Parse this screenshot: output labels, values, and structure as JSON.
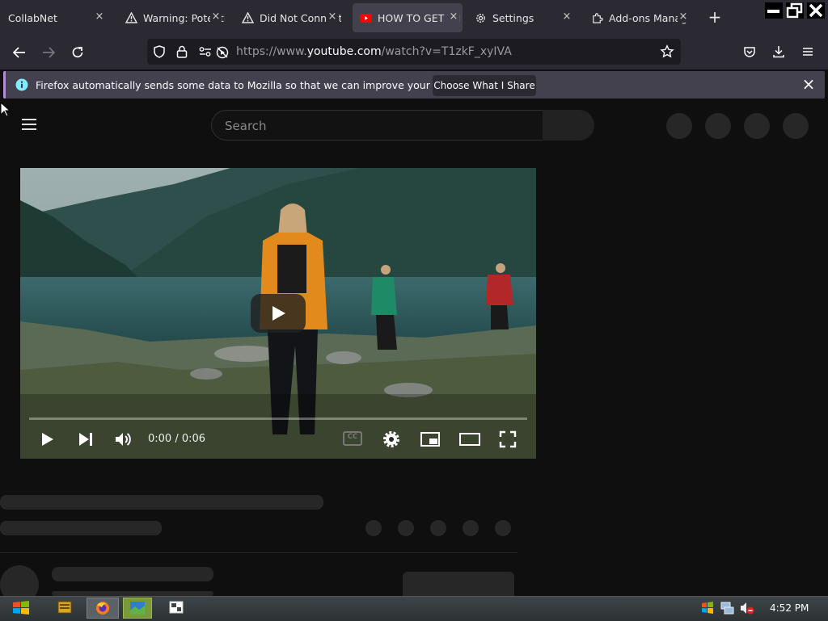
{
  "browser": {
    "tabs": [
      {
        "label": "CollabNet",
        "icon": "none"
      },
      {
        "label": "Warning: Potenti",
        "icon": "warning-icon"
      },
      {
        "label": "Did Not Connect",
        "icon": "warning-icon"
      },
      {
        "label": "HOW TO GET WI",
        "icon": "youtube-icon",
        "active": true
      },
      {
        "label": "Settings",
        "icon": "gear-icon"
      },
      {
        "label": "Add-ons Manag",
        "icon": "puzzle-icon"
      }
    ],
    "tab_close_glyph": "×",
    "new_tab_glyph": "+",
    "url": {
      "prefix": "https://www.",
      "host": "youtube.com",
      "path": "/watch?v=T1zkF_xyIVA"
    }
  },
  "notification": {
    "message": "Firefox automatically sends some data to Mozilla so that we can improve your experience.",
    "button_label": "Choose What I Share",
    "close_glyph": "×"
  },
  "youtube": {
    "search_placeholder": "Search",
    "player": {
      "time": "0:00 / 0:06",
      "cc_label": "CC",
      "progress": 0.0
    }
  },
  "taskbar": {
    "clock": "4:52 PM"
  },
  "colors": {
    "accent": "#b38bd9",
    "youtube_red": "#ff0000",
    "page_bg": "#0f0f0f",
    "chrome_bg": "#2b2a33"
  }
}
